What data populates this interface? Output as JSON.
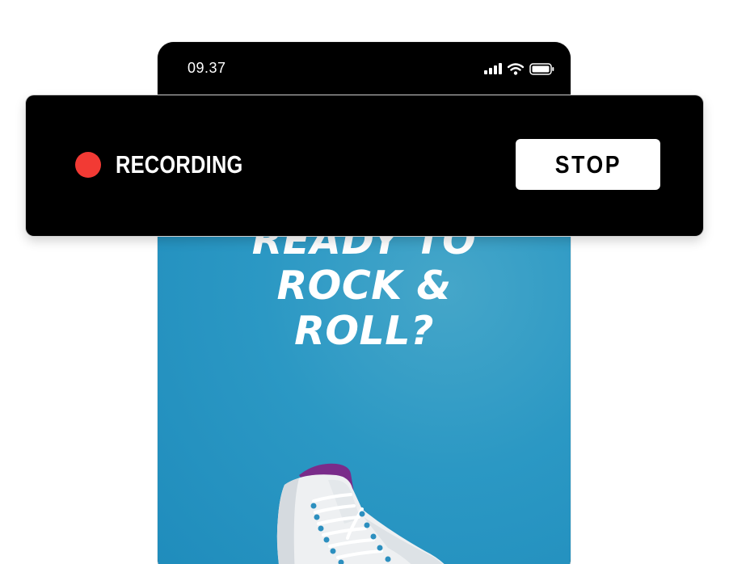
{
  "status_bar": {
    "time": "09.37",
    "icons": [
      "signal-icon",
      "wifi-icon",
      "battery-icon"
    ]
  },
  "story": {
    "headline_lines": [
      "READY TO",
      "ROCK &",
      "ROLL?"
    ],
    "background_color": "#2b98c4"
  },
  "recording_bar": {
    "label": "RECORDING",
    "stop_label": "STOP",
    "indicator_color": "#f23a34"
  }
}
